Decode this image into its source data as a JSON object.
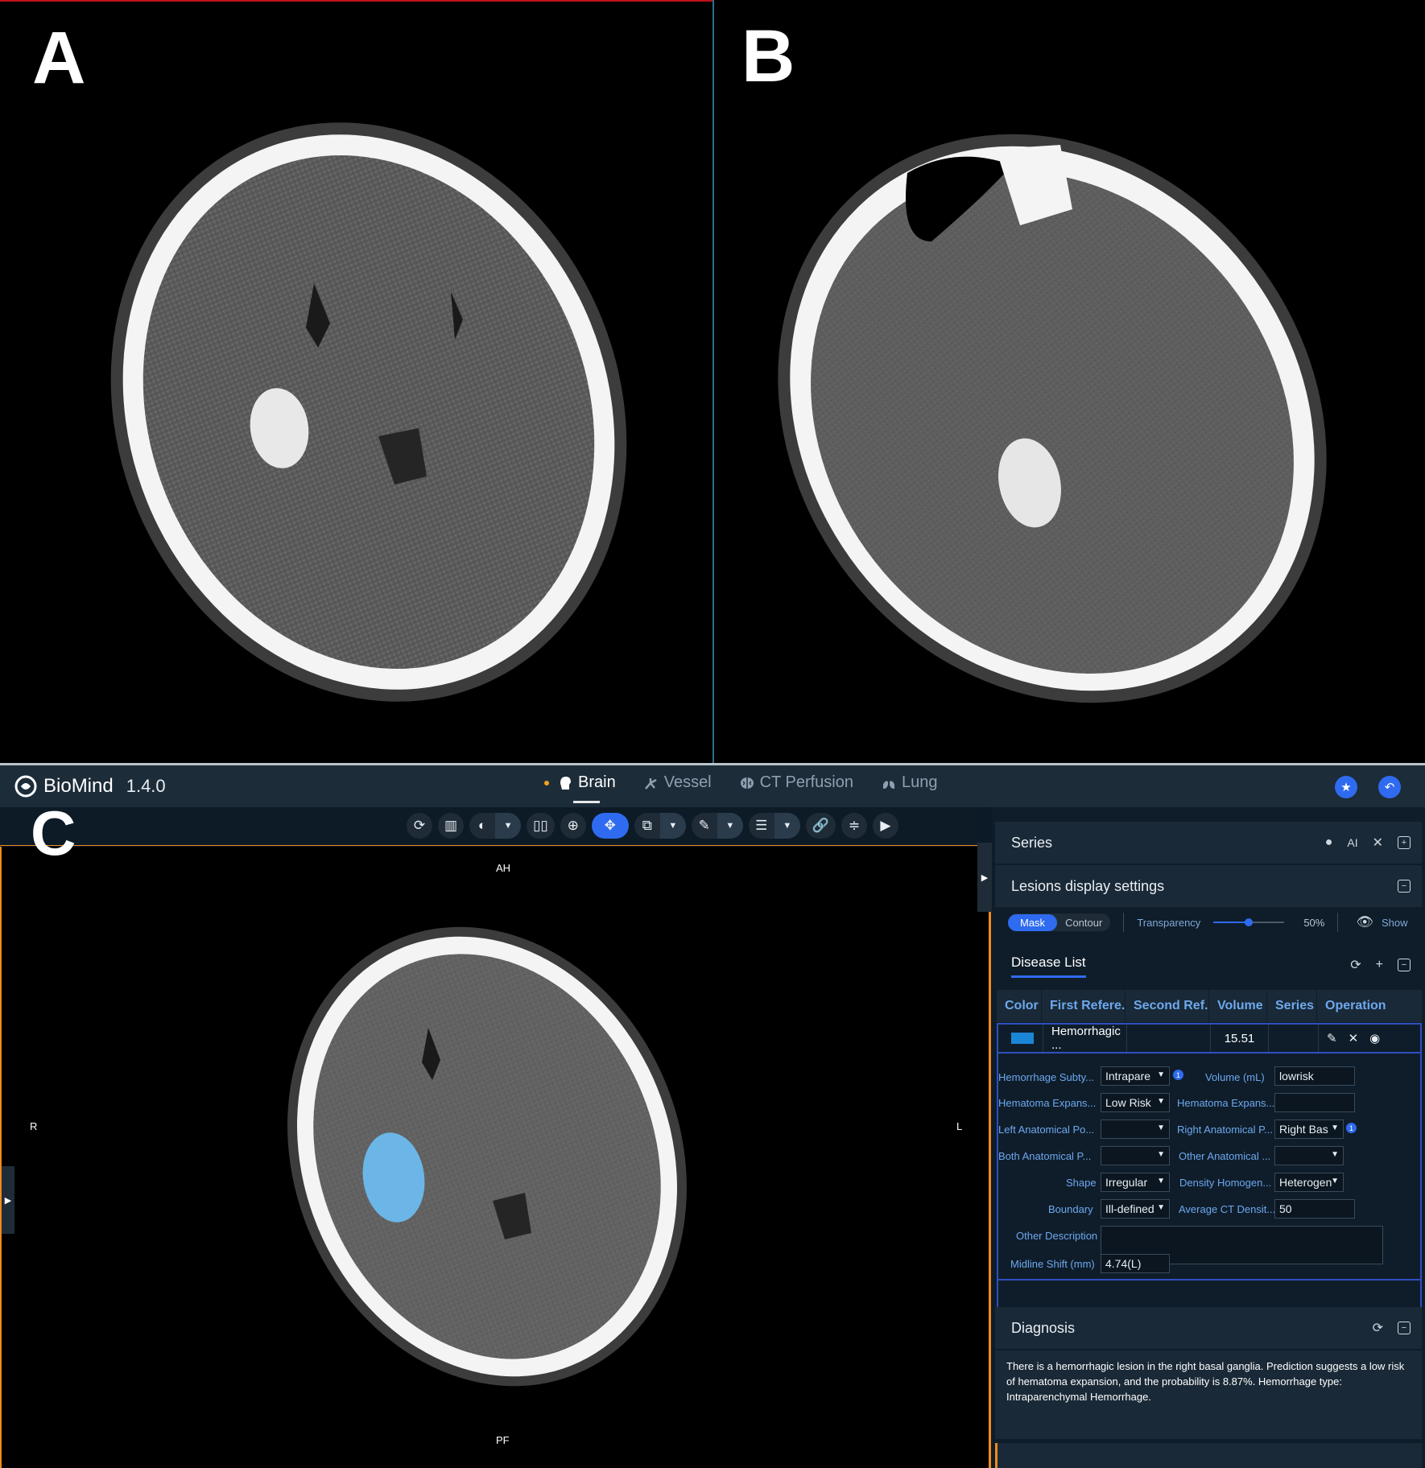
{
  "panels": {
    "a_label": "A",
    "b_label": "B",
    "c_label": "C"
  },
  "app": {
    "brand": "BioMind",
    "version": "1.4.0",
    "modes": [
      {
        "label": "Brain",
        "icon": "head-icon"
      },
      {
        "label": "Vessel",
        "icon": "vessel-icon"
      },
      {
        "label": "CT Perfusion",
        "icon": "brain-icon"
      },
      {
        "label": "Lung",
        "icon": "lung-icon"
      }
    ],
    "active_mode": "Brain"
  },
  "viewer": {
    "orientation": {
      "top": "AH",
      "left": "R",
      "right": "L",
      "bottom": "PF"
    }
  },
  "side": {
    "series_title": "Series",
    "series_ai": "AI",
    "lesions_title": "Lesions display settings",
    "mask_label": "Mask",
    "contour_label": "Contour",
    "transparency_label": "Transparency",
    "transparency_value": "50%",
    "transparency_fraction": 0.5,
    "show_label": "Show",
    "disease_title": "Disease List",
    "columns": [
      "Color",
      "First Refere...",
      "Second Ref...",
      "Volume",
      "Series",
      "Operation"
    ],
    "row": {
      "first": "Hemorrhagic ...",
      "second": "",
      "volume": "15.51",
      "series": ""
    },
    "fields": {
      "subtype_label": "Hemorrhage Subty...",
      "subtype_value": "Intrapare",
      "volume_label": "Volume (mL)",
      "volume_value": "lowrisk",
      "expans_label": "Hematoma Expans...",
      "expans_value": "Low Risk",
      "expans2_label": "Hematoma Expans...",
      "expans2_value": "",
      "left_anat_label": "Left Anatomical Po...",
      "left_anat_value": "",
      "right_anat_label": "Right Anatomical P...",
      "right_anat_value": "Right Bas",
      "both_anat_label": "Both Anatomical P...",
      "both_anat_value": "",
      "other_anat_label": "Other Anatomical ...",
      "other_anat_value": "",
      "shape_label": "Shape",
      "shape_value": "Irregular",
      "density_label": "Density Homogen...",
      "density_value": "Heterogen",
      "boundary_label": "Boundary",
      "boundary_value": "Ill-defined",
      "avg_ct_label": "Average CT Densit...",
      "avg_ct_value": "50",
      "other_desc_label": "Other Description",
      "other_desc_value": "",
      "midline_label": "Midline Shift (mm)",
      "midline_value": "4.74(L)"
    },
    "info_badge": "1",
    "diagnosis_title": "Diagnosis",
    "diagnosis_text": "There is a hemorrhagic lesion in the right basal ganglia. Prediction suggests a low risk of hematoma expansion, and the probability is 8.87%. Hemorrhage type: Intraparenchymal Hemorrhage."
  },
  "colors": {
    "accent": "#2f6bf0",
    "warning_border": "#f08a1a",
    "lesion_mask": "#6bb6e6",
    "swatch": "#1b86d6"
  }
}
